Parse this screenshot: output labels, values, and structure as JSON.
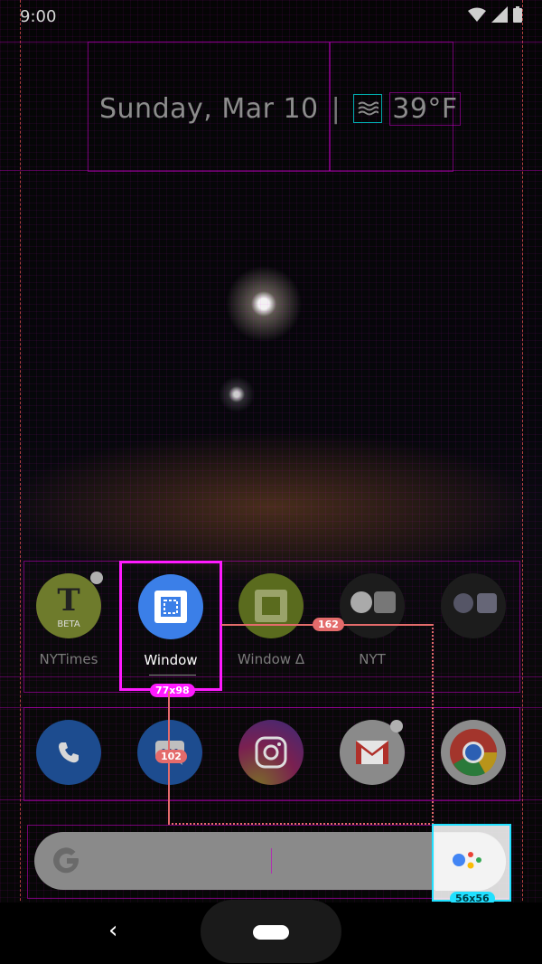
{
  "status_bar": {
    "time": "9:00"
  },
  "date_widget": {
    "date": "Sunday, Mar 10",
    "separator": "|",
    "temperature": "39°F"
  },
  "home_apps": [
    {
      "label": "NYTimes",
      "icon": "nytimes-beta-icon"
    },
    {
      "label": "Window",
      "icon": "window-app-icon"
    },
    {
      "label": "Window Δ",
      "icon": "window-delta-icon"
    },
    {
      "label": "NYT",
      "icon": "nyt-folder-icon"
    },
    {
      "label": "",
      "icon": "google-apps-folder-icon"
    }
  ],
  "nytimes_badge": "BETA",
  "dock": [
    {
      "name": "Phone",
      "icon": "phone-icon"
    },
    {
      "name": "Messages",
      "icon": "messages-icon"
    },
    {
      "name": "Instagram",
      "icon": "instagram-icon"
    },
    {
      "name": "Gmail",
      "icon": "gmail-icon"
    },
    {
      "name": "Chrome",
      "icon": "chrome-icon"
    }
  ],
  "overlay": {
    "selected_size": "77x98",
    "assist_size": "56x56",
    "horizontal_distance": "162",
    "vertical_distance": "102"
  },
  "colors": {
    "selection": "#ff00ff",
    "assist_selection": "#21e0ff",
    "measure": "#e46b6b",
    "window_blue": "#3b7fe8"
  }
}
